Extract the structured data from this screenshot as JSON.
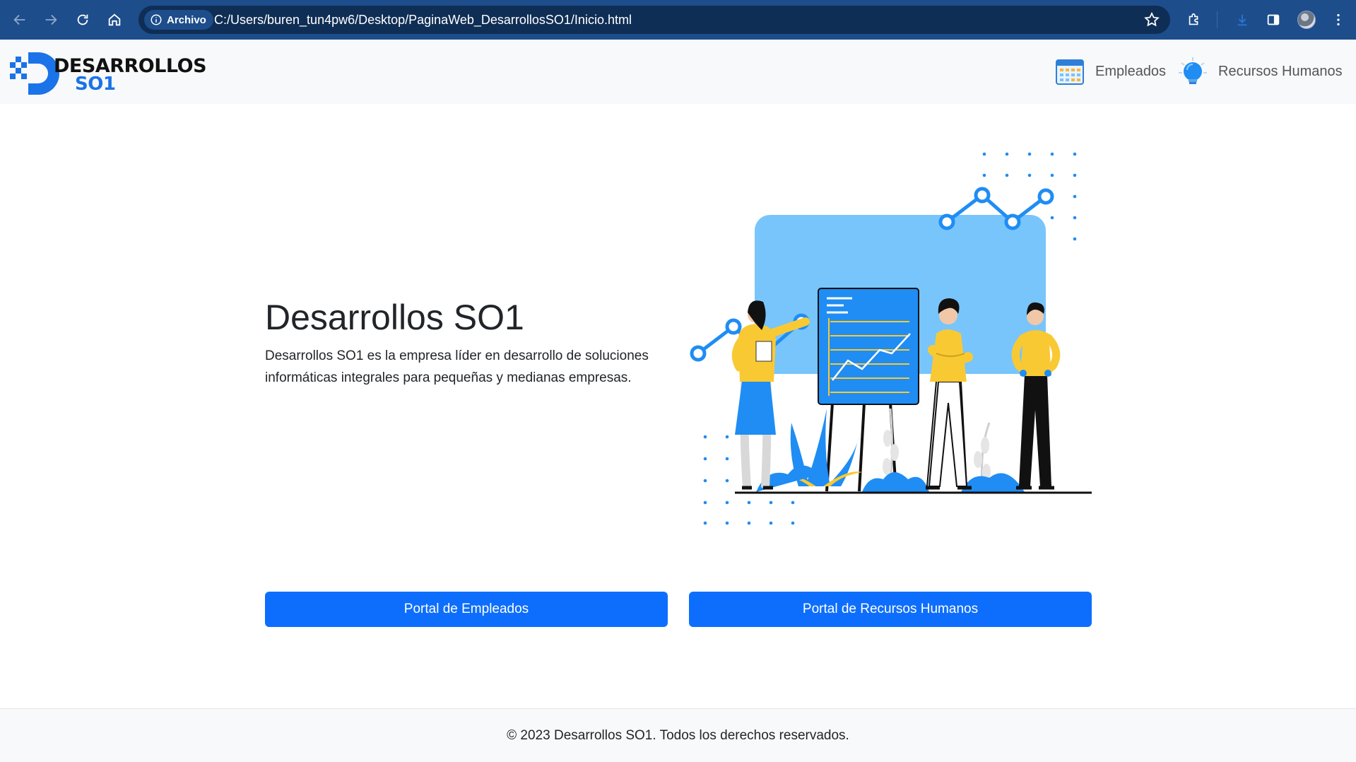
{
  "browser": {
    "site_chip_label": "Archivo",
    "url": "C:/Users/buren_tun4pw6/Desktop/PaginaWeb_DesarrollosSO1/Inicio.html"
  },
  "header": {
    "logo_line1": "DESARROLLOS",
    "logo_line2": "SO1",
    "nav": [
      {
        "label": "Empleados",
        "icon": "calendar-icon"
      },
      {
        "label": "Recursos Humanos",
        "icon": "lightbulb-icon"
      }
    ]
  },
  "hero": {
    "title": "Desarrollos SO1",
    "description": "Desarrollos SO1 es la empresa líder en desarrollo de soluciones informáticas integrales para pequeñas y medianas empresas."
  },
  "buttons": {
    "employees": "Portal de Empleados",
    "hr": "Portal de Recursos Humanos"
  },
  "footer": {
    "text": "© 2023 Desarrollos SO1. Todos los derechos reservados."
  },
  "colors": {
    "chrome": "#1d4d8b",
    "primary": "#0d6efd",
    "light_blue": "#78c5fb",
    "yellow": "#f9c933"
  }
}
